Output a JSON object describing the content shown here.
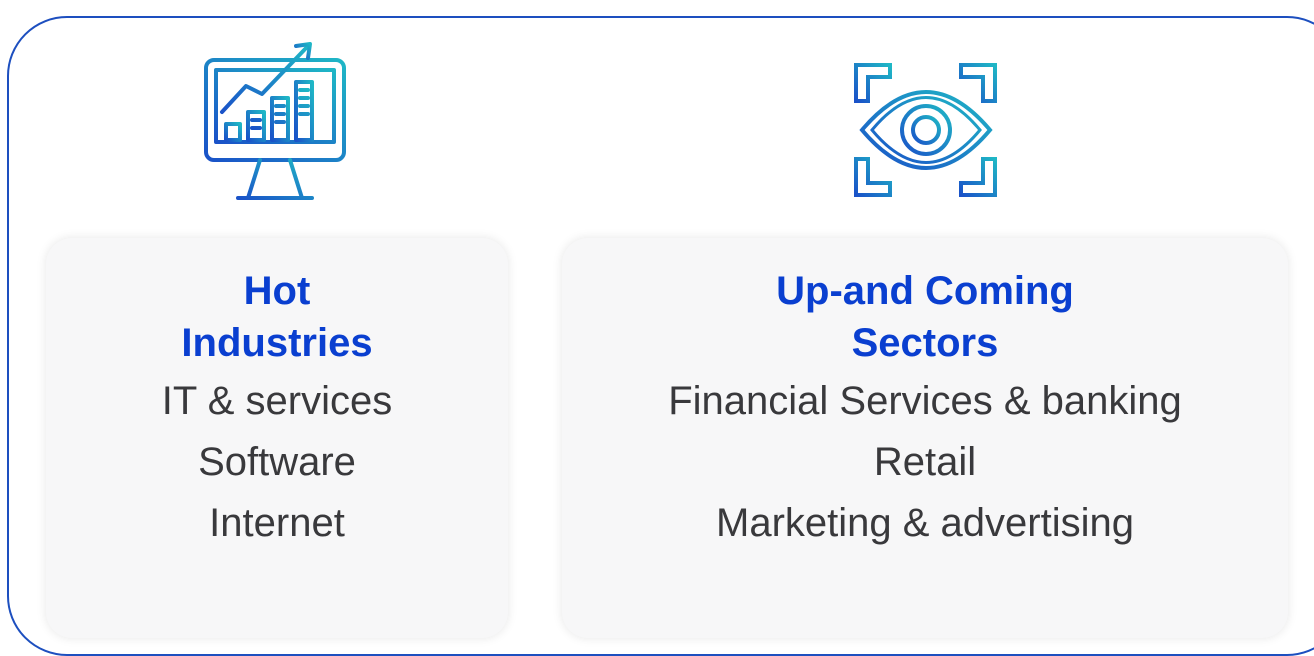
{
  "cards": [
    {
      "icon": "analytics-monitor-icon",
      "title_lines": [
        "Hot",
        "Industries"
      ],
      "items": [
        "IT & services",
        "Software",
        "Internet"
      ]
    },
    {
      "icon": "eye-focus-icon",
      "title_lines": [
        "Up-and Coming",
        "Sectors"
      ],
      "items": [
        "Financial Services & banking",
        "Retail",
        "Marketing & advertising"
      ]
    }
  ],
  "colors": {
    "title": "#0a3fd0",
    "text": "#39393c",
    "icon_gradient_start": "#1a52c8",
    "icon_gradient_end": "#1fb7c6",
    "frame": "#1d4fbf",
    "card_bg": "#f7f7f8"
  }
}
